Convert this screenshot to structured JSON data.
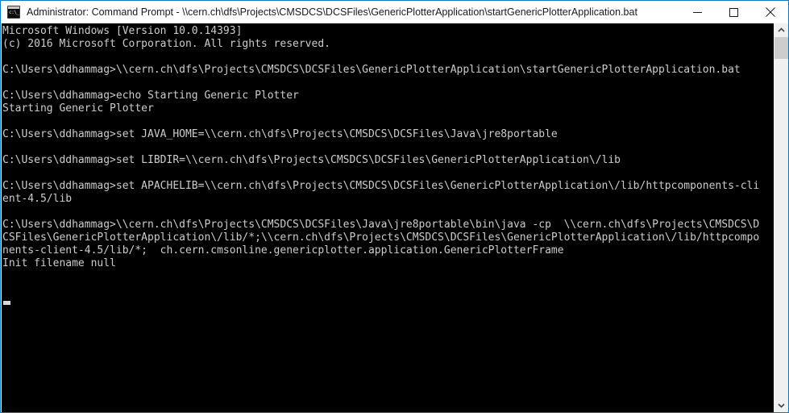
{
  "window": {
    "title": "Administrator: Command Prompt - \\\\cern.ch\\dfs\\Projects\\CMSDCS\\DCSFiles\\GenericPlotterApplication\\startGenericPlotterApplication.bat",
    "icon_name": "command-prompt-icon",
    "icon_text": "c:\\_",
    "border_color": "#0a7ac4",
    "titlebar_bg": "#ffffff",
    "titlebar_fg": "#1a1a1a"
  },
  "titlebar_buttons": {
    "minimize_label": "—",
    "maximize_label": "□",
    "close_label": "✕"
  },
  "console": {
    "background": "#000000",
    "foreground": "#cccccc",
    "cursor_visible": true,
    "lines": [
      "Microsoft Windows [Version 10.0.14393]",
      "(c) 2016 Microsoft Corporation. All rights reserved.",
      "",
      "C:\\Users\\ddhammag>\\\\cern.ch\\dfs\\Projects\\CMSDCS\\DCSFiles\\GenericPlotterApplication\\startGenericPlotterApplication.bat",
      "",
      "C:\\Users\\ddhammag>echo Starting Generic Plotter",
      "Starting Generic Plotter",
      "",
      "C:\\Users\\ddhammag>set JAVA_HOME=\\\\cern.ch\\dfs\\Projects\\CMSDCS\\DCSFiles\\Java\\jre8portable",
      "",
      "C:\\Users\\ddhammag>set LIBDIR=\\\\cern.ch\\dfs\\Projects\\CMSDCS\\DCSFiles\\GenericPlotterApplication\\/lib",
      "",
      "C:\\Users\\ddhammag>set APACHELIB=\\\\cern.ch\\dfs\\Projects\\CMSDCS\\DCSFiles\\GenericPlotterApplication\\/lib/httpcomponents-cli",
      "ent-4.5/lib",
      "",
      "C:\\Users\\ddhammag>\\\\cern.ch\\dfs\\Projects\\CMSDCS\\DCSFiles\\Java\\jre8portable\\bin\\java -cp  \\\\cern.ch\\dfs\\Projects\\CMSDCS\\D",
      "CSFiles\\GenericPlotterApplication\\/lib/*;\\\\cern.ch\\dfs\\Projects\\CMSDCS\\DCSFiles\\GenericPlotterApplication\\/lib/httpcompo",
      "nents-client-4.5/lib/*;  ch.cern.cmsonline.genericplotter.application.GenericPlotterFrame",
      "Init filename null"
    ]
  },
  "scrollbar": {
    "up_arrow": "ⱏ",
    "down_arrow": "ⱛ",
    "thumb_color": "#cdcdcd",
    "track_color": "#f0f0f0"
  }
}
